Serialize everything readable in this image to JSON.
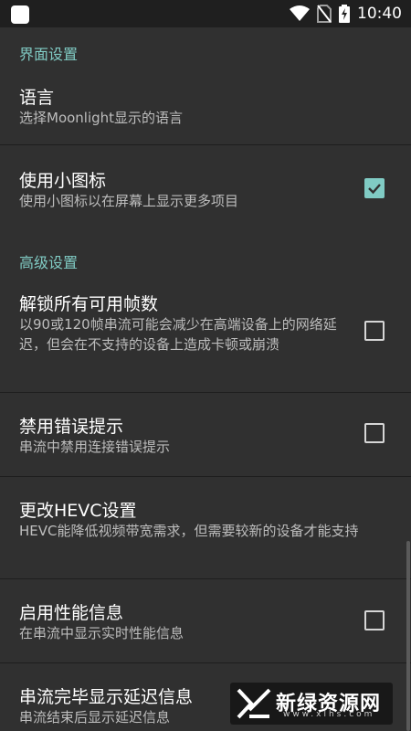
{
  "status_bar": {
    "time": "10:40"
  },
  "sections": {
    "ui_settings": {
      "title": "界面设置"
    },
    "advanced_settings": {
      "title": "高级设置"
    }
  },
  "settings": {
    "language": {
      "title": "语言",
      "summary": "选择Moonlight显示的语言"
    },
    "small_icons": {
      "title": "使用小图标",
      "summary": "使用小图标以在屏幕上显示更多项目",
      "checked": true
    },
    "unlock_fps": {
      "title": "解锁所有可用帧数",
      "summary": "以90或120帧串流可能会减少在高端设备上的网络延迟，但会在不支持的设备上造成卡顿或崩溃",
      "checked": false
    },
    "disable_errors": {
      "title": "禁用错误提示",
      "summary": "串流中禁用连接错误提示",
      "checked": false
    },
    "hevc": {
      "title": "更改HEVC设置",
      "summary": "HEVC能降低视频带宽需求，但需要较新的设备才能支持"
    },
    "perf_overlay": {
      "title": "启用性能信息",
      "summary": "在串流中显示实时性能信息",
      "checked": false
    },
    "latency_toast": {
      "title": "串流完毕显示延迟信息",
      "summary": "串流结束后显示延迟信息"
    }
  },
  "watermark": {
    "name": "新绿资源网",
    "url": "www.xlhs.com"
  },
  "colors": {
    "accent": "#80cbc4",
    "background": "#303030",
    "status_bar": "#1f1f1f"
  }
}
